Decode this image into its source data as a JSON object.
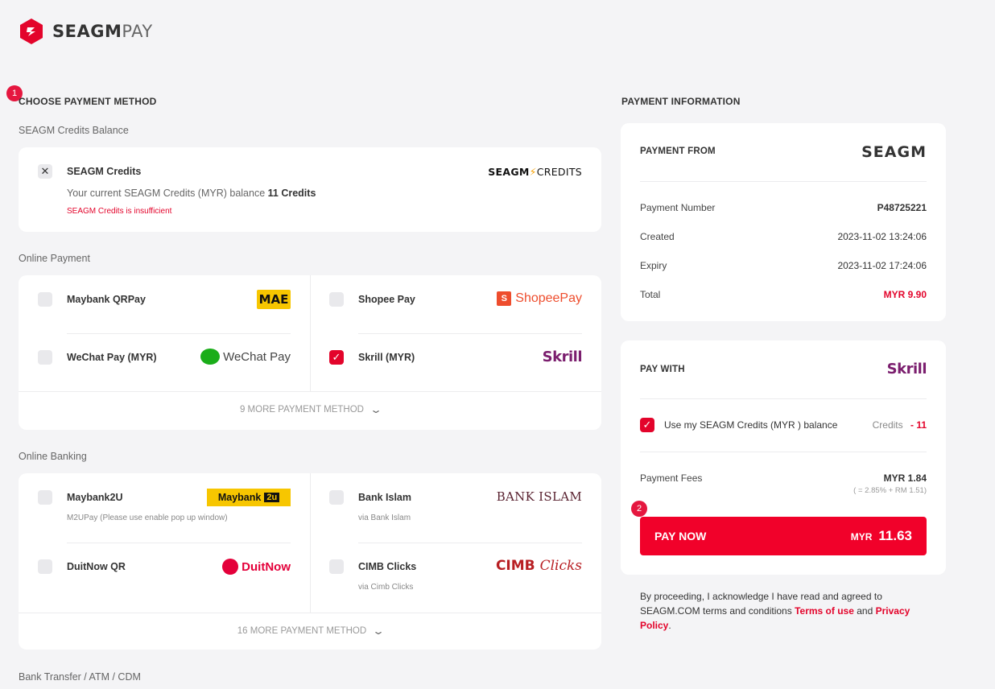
{
  "header": {
    "brand": "SEAGM",
    "brand_suffix": "PAY"
  },
  "steps": {
    "one": "1",
    "two": "2"
  },
  "left": {
    "section_title": "CHOOSE PAYMENT METHOD",
    "credits_label": "SEAGM Credits Balance",
    "credits": {
      "name": "SEAGM Credits",
      "balance_prefix": "Your current SEAGM Credits (MYR) balance",
      "balance_value": "11 Credits",
      "error": "SEAGM Credits is insufficient",
      "logo_a": "SEAGM",
      "logo_b": "CREDITS"
    },
    "online_payment_label": "Online Payment",
    "online_payment": [
      {
        "name": "Maybank QRPay",
        "logo": "MAE",
        "checked": false
      },
      {
        "name": "Shopee Pay",
        "logo": "ShopeePay",
        "checked": false
      },
      {
        "name": "WeChat Pay (MYR)",
        "logo": "WeChat Pay",
        "checked": false
      },
      {
        "name": "Skrill (MYR)",
        "logo": "Skrill",
        "checked": true
      }
    ],
    "online_payment_more": "9 MORE PAYMENT METHOD",
    "online_banking_label": "Online Banking",
    "online_banking": [
      {
        "name": "Maybank2U",
        "sub": "M2UPay (Please use enable pop up window)",
        "logo_a": "Maybank",
        "logo_b": "2u"
      },
      {
        "name": "Bank Islam",
        "sub": "via Bank Islam",
        "logo": "BANK ISLAM"
      },
      {
        "name": "DuitNow QR",
        "sub": "",
        "logo": "DuitNow"
      },
      {
        "name": "CIMB Clicks",
        "sub": "via Cimb Clicks",
        "logo_a": "CIMB",
        "logo_b": "Clicks"
      }
    ],
    "online_banking_more": "16 MORE PAYMENT METHOD",
    "bank_transfer_label": "Bank Transfer / ATM / CDM"
  },
  "right": {
    "section_title": "PAYMENT INFORMATION",
    "payment_from": {
      "title": "PAYMENT FROM",
      "logo": "SEAGM",
      "rows": [
        {
          "k": "Payment Number",
          "v": "P48725221"
        },
        {
          "k": "Created",
          "v": "2023-11-02 13:24:06"
        },
        {
          "k": "Expiry",
          "v": "2023-11-02 17:24:06"
        },
        {
          "k": "Total",
          "v": "MYR 9.90"
        }
      ]
    },
    "pay_with": {
      "title": "PAY WITH",
      "logo": "Skrill",
      "use_credits_label": "Use my SEAGM Credits (MYR ) balance",
      "credits_label": "Credits",
      "credits_value": "- 11",
      "fees_label": "Payment Fees",
      "fees_value": "MYR 1.84",
      "fees_note": "( = 2.85% + RM 1.51)",
      "pay_now_label": "PAY NOW",
      "pay_now_currency": "MYR",
      "pay_now_amount": "11.63"
    },
    "legal": {
      "text": "By proceeding, I acknowledge I have read and agreed to SEAGM.COM terms and conditions",
      "terms": "Terms of use",
      "and": "and",
      "privacy": "Privacy Policy",
      "end": "."
    }
  },
  "colors": {
    "accent": "#e3042b",
    "skrill": "#7b1e6e",
    "bg": "#f4f4f6"
  }
}
